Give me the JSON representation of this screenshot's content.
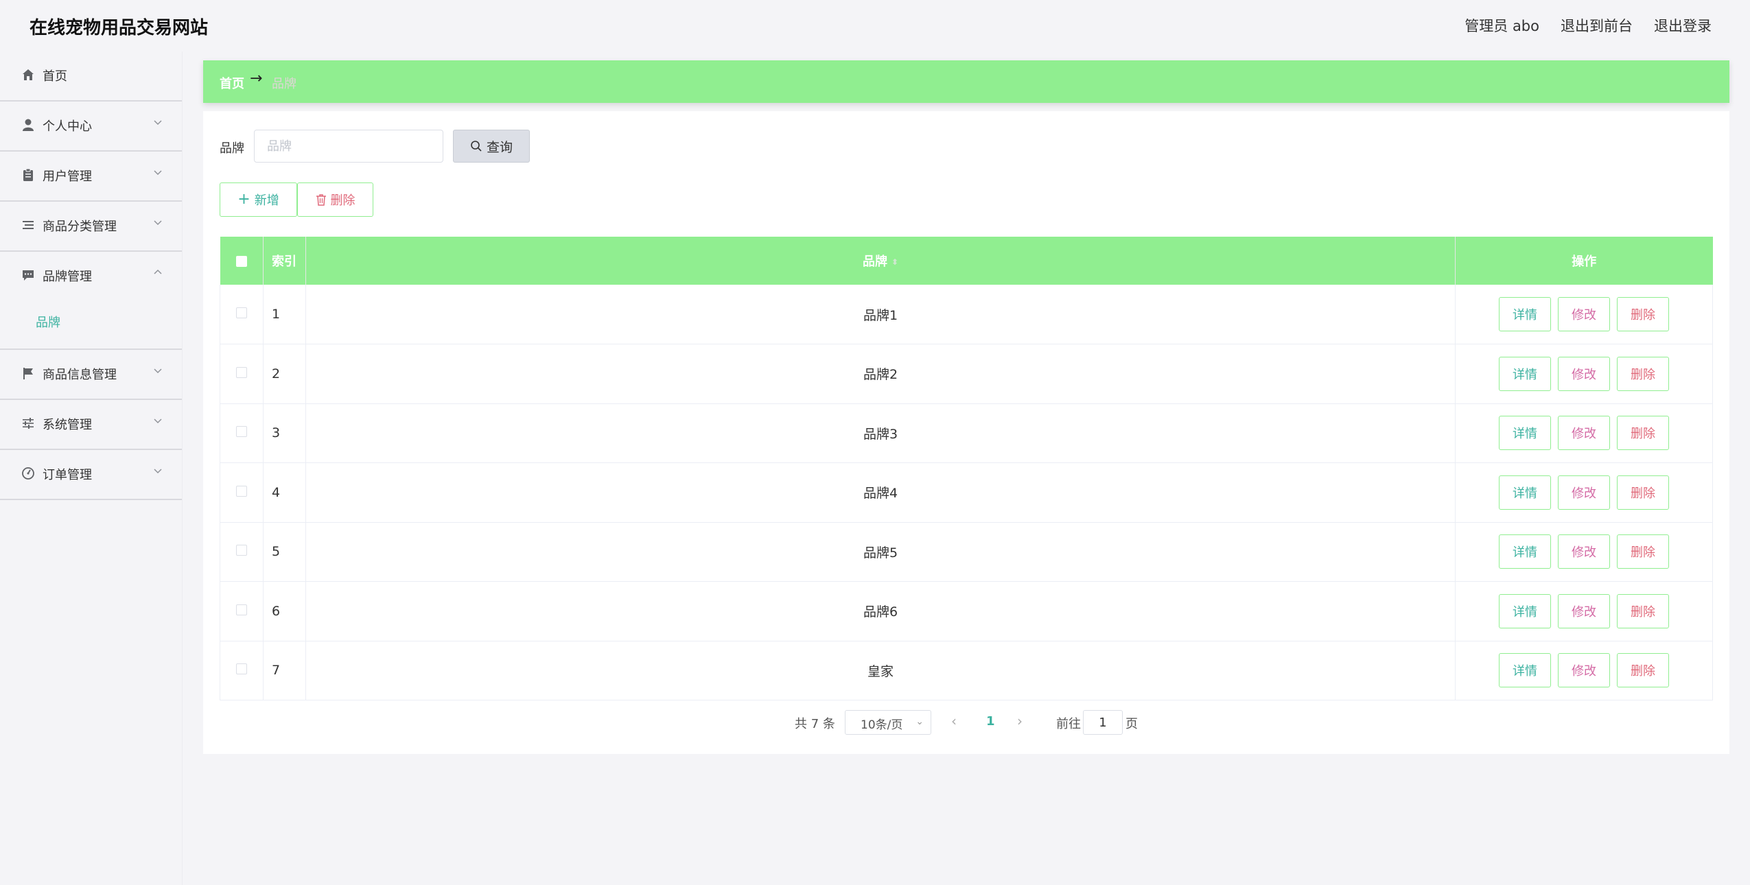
{
  "header": {
    "site_title": "在线宠物用品交易网站",
    "admin_label": "管理员 abo",
    "exit_front": "退出到前台",
    "logout": "退出登录"
  },
  "sidebar": {
    "items": [
      {
        "label": "首页",
        "icon": "home-icon"
      },
      {
        "label": "个人中心",
        "icon": "user-icon"
      },
      {
        "label": "用户管理",
        "icon": "clipboard-icon"
      },
      {
        "label": "商品分类管理",
        "icon": "list-icon"
      },
      {
        "label": "品牌管理",
        "icon": "chat-icon"
      },
      {
        "label": "商品信息管理",
        "icon": "flag-icon"
      },
      {
        "label": "系统管理",
        "icon": "sliders-icon"
      },
      {
        "label": "订单管理",
        "icon": "gauge-icon"
      }
    ],
    "sub_item": "品牌"
  },
  "breadcrumb": {
    "home": "首页",
    "arrow": "→",
    "current": "品牌"
  },
  "search": {
    "label": "品牌",
    "placeholder": "品牌",
    "button": "查询"
  },
  "actions": {
    "add": "新增",
    "delete": "删除"
  },
  "table": {
    "headers": {
      "index": "索引",
      "brand": "品牌",
      "ops": "操作"
    },
    "op_labels": {
      "detail": "详情",
      "edit": "修改",
      "delete": "删除"
    },
    "rows": [
      {
        "index": "1",
        "brand": "品牌1"
      },
      {
        "index": "2",
        "brand": "品牌2"
      },
      {
        "index": "3",
        "brand": "品牌3"
      },
      {
        "index": "4",
        "brand": "品牌4"
      },
      {
        "index": "5",
        "brand": "品牌5"
      },
      {
        "index": "6",
        "brand": "品牌6"
      },
      {
        "index": "7",
        "brand": "皇家"
      }
    ]
  },
  "pagination": {
    "total": "共 7 条",
    "page_size": "10条/页",
    "current_page": "1",
    "goto_label": "前往",
    "goto_value": "1",
    "page_suffix": "页"
  },
  "colors": {
    "accent_green": "#90ee90",
    "teal": "#3cb2a0",
    "pink": "#d46ba5",
    "red": "#e0697a"
  }
}
